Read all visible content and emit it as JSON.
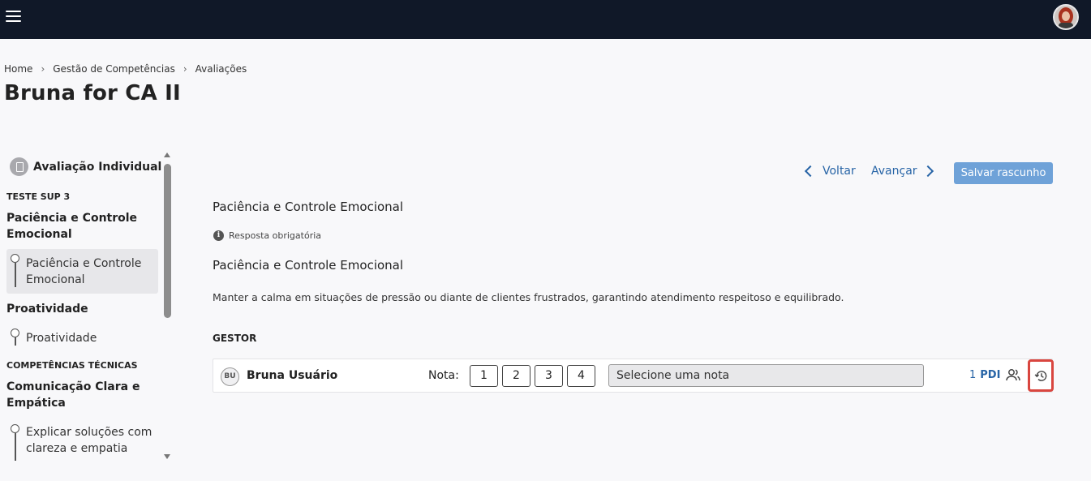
{
  "header": {
    "menu_icon": "hamburger-menu-icon",
    "avatar_icon": "user-avatar"
  },
  "breadcrumb": [
    "Home",
    "Gestão de Competências",
    "Avaliações"
  ],
  "page_title": "Bruna for CA II",
  "sidebar": {
    "header": "Avaliação Individual",
    "sections": [
      "TESTE SUP 3",
      "COMPETÊNCIAS TÉCNICAS"
    ],
    "groups": [
      "Paciência e Controle Emocional",
      "Proatividade",
      "Comunicação Clara e Empática"
    ],
    "items": [
      "Paciência e Controle Emocional",
      "Proatividade",
      "Explicar soluções com clareza e empatia"
    ]
  },
  "nav": {
    "back": "Voltar",
    "forward": "Avançar",
    "save": "Salvar rascunho"
  },
  "question": {
    "title": "Paciência e Controle Emocional",
    "required": "Resposta obrigatória",
    "competency_title": "Paciência e Controle Emocional",
    "description": "Manter a calma em situações de pressão ou diante de clientes frustrados, garantindo atendimento respeitoso e equilibrado.",
    "role": "GESTOR"
  },
  "evaluation": {
    "initials": "BU",
    "user_name": "Bruna Usuário",
    "nota_label": "Nota:",
    "grades": [
      "1",
      "2",
      "3",
      "4"
    ],
    "select_placeholder": "Selecione uma nota",
    "pdi_count": "1",
    "pdi_label": "PDI"
  },
  "colors": {
    "topbar": "#101828",
    "link": "#2764a6",
    "save_button": "#6fa2d8",
    "highlight": "#d9463f"
  }
}
